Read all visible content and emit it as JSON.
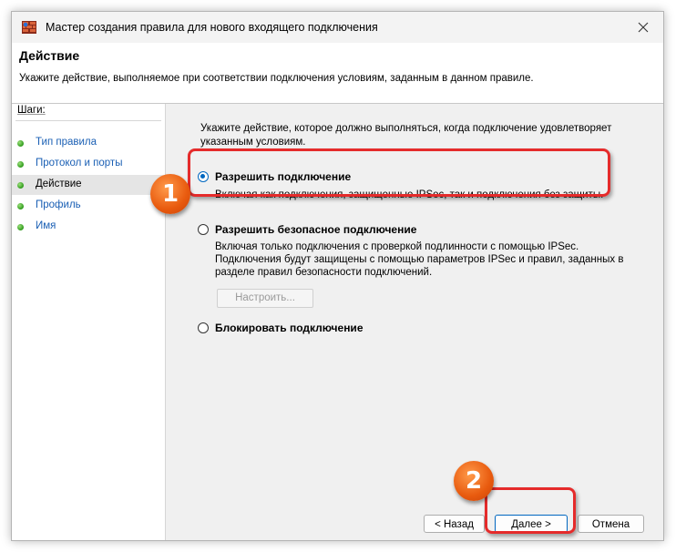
{
  "window": {
    "title": "Мастер создания правила для нового входящего подключения",
    "icon": "firewall-wall-icon"
  },
  "header": {
    "title": "Действие",
    "description": "Укажите действие, выполняемое при соответствии подключения условиям, заданным в данном правиле."
  },
  "steps": {
    "title": "Шаги:",
    "items": [
      {
        "label": "Тип правила",
        "active": false
      },
      {
        "label": "Протокол и порты",
        "active": false
      },
      {
        "label": "Действие",
        "active": true
      },
      {
        "label": "Профиль",
        "active": false
      },
      {
        "label": "Имя",
        "active": false
      }
    ]
  },
  "main": {
    "intro": "Укажите действие, которое должно выполняться, когда подключение удовлетворяет указанным условиям.",
    "options": [
      {
        "label": "Разрешить подключение",
        "checked": true,
        "description": "Включая как подключения, защищенные IPSec, так и подключения без защиты."
      },
      {
        "label": "Разрешить безопасное подключение",
        "checked": false,
        "description_lines": [
          "Включая только подключения с проверкой подлинности с помощью IPSec.",
          "Подключения будут защищены с помощью параметров IPSec и правил, заданных в",
          "разделе правил безопасности подключений."
        ]
      },
      {
        "label": "Блокировать подключение",
        "checked": false
      }
    ],
    "customize_label": "Настроить..."
  },
  "footer": {
    "back_label": "< Назад",
    "next_label": "Далее >",
    "cancel_label": "Отмена"
  },
  "annotations": {
    "badge_1": "1",
    "badge_2": "2",
    "color": "#e52b2b",
    "badge_color": "#e85a0e"
  }
}
